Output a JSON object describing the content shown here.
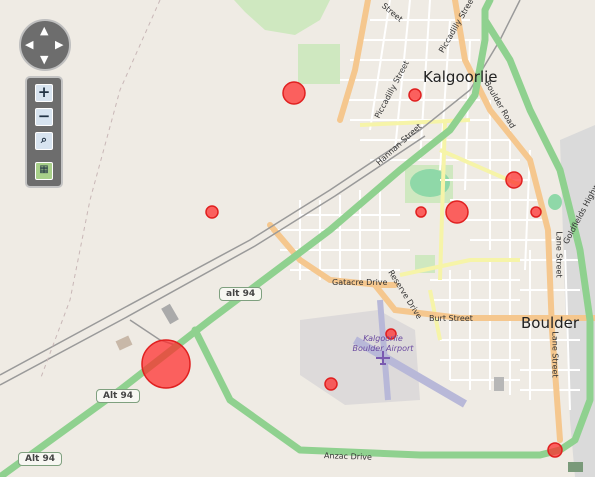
{
  "map": {
    "place_labels": {
      "kalgoorlie": "Kalgoorlie",
      "boulder": "Boulder",
      "airport": "Kalgoorlie Boulder Airport"
    },
    "street_labels": {
      "hannan": "Hannan Street",
      "piccadilly_1": "Piccadilly Street",
      "piccadilly_2": "Piccadilly Street",
      "boulder_road": "Boulder Road",
      "goldfields": "Goldfields Highway",
      "gatacre": "Gatacre Drive",
      "reserve": "Reserve Drive",
      "burt": "Burt Street",
      "lane_1": "Lane Street",
      "lane_2": "Lane Street",
      "anzac": "Anzac Drive",
      "top_street": "Street"
    },
    "route_shields": {
      "alt94_lower": "Alt 94",
      "alt94_mid": "Alt 94",
      "alt94_upper": "alt 94"
    },
    "markers_color": "#ff2a2a",
    "controls": {
      "pan_icon": "pan-arrows-icon",
      "zoom_in_icon": "zoom-in-icon",
      "zoom_out_icon": "zoom-out-icon",
      "zoom_extent_icon": "zoom-extent-icon",
      "layer_select_icon": "layer-select-icon"
    },
    "colors": {
      "background": "#efebe4",
      "major_road": "#8fd18f",
      "secondary_road": "#f5c78e",
      "tertiary_road": "#f6f4a8",
      "railway": "#999999",
      "park": "#cfe8c0"
    }
  }
}
